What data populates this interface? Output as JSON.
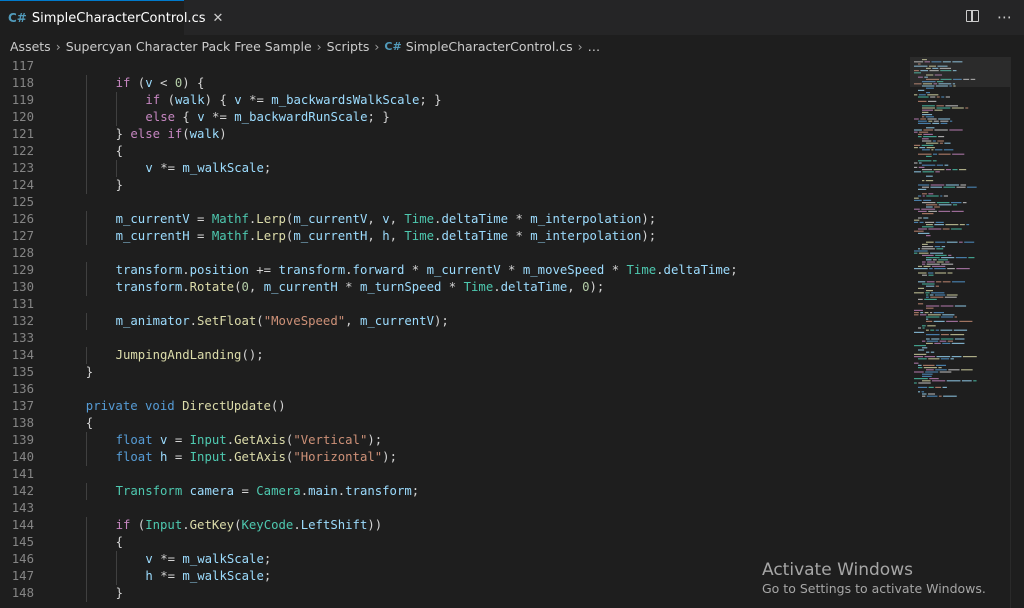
{
  "tab": {
    "icon": "C#",
    "title": "SimpleCharacterControl.cs",
    "close": "✕"
  },
  "actions": {
    "more": "⋯"
  },
  "breadcrumb": {
    "items": [
      "Assets",
      "Supercyan Character Pack Free Sample",
      "Scripts"
    ],
    "file_icon": "C#",
    "file": "SimpleCharacterControl.cs",
    "more": "…"
  },
  "code": {
    "lines": [
      {
        "n": "117",
        "t": ""
      },
      {
        "n": "118",
        "t": "if (v < 0) {"
      },
      {
        "n": "119",
        "t": "if (walk) { v *= m_backwardsWalkScale; }"
      },
      {
        "n": "120",
        "t": "else { v *= m_backwardRunScale; }"
      },
      {
        "n": "121",
        "t": "} else if(walk)"
      },
      {
        "n": "122",
        "t": "{"
      },
      {
        "n": "123",
        "t": "v *= m_walkScale;"
      },
      {
        "n": "124",
        "t": "}"
      },
      {
        "n": "125",
        "t": ""
      },
      {
        "n": "126",
        "t": "m_currentV = Mathf.Lerp(m_currentV, v, Time.deltaTime * m_interpolation);"
      },
      {
        "n": "127",
        "t": "m_currentH = Mathf.Lerp(m_currentH, h, Time.deltaTime * m_interpolation);"
      },
      {
        "n": "128",
        "t": ""
      },
      {
        "n": "129",
        "t": "transform.position += transform.forward * m_currentV * m_moveSpeed * Time.deltaTime;"
      },
      {
        "n": "130",
        "t": "transform.Rotate(0, m_currentH * m_turnSpeed * Time.deltaTime, 0);"
      },
      {
        "n": "131",
        "t": ""
      },
      {
        "n": "132",
        "t": "m_animator.SetFloat(\"MoveSpeed\", m_currentV);"
      },
      {
        "n": "133",
        "t": ""
      },
      {
        "n": "134",
        "t": "JumpingAndLanding();"
      },
      {
        "n": "135",
        "t": "}"
      },
      {
        "n": "136",
        "t": ""
      },
      {
        "n": "137",
        "t": "private void DirectUpdate()"
      },
      {
        "n": "138",
        "t": "{"
      },
      {
        "n": "139",
        "t": "float v = Input.GetAxis(\"Vertical\");"
      },
      {
        "n": "140",
        "t": "float h = Input.GetAxis(\"Horizontal\");"
      },
      {
        "n": "141",
        "t": ""
      },
      {
        "n": "142",
        "t": "Transform camera = Camera.main.transform;"
      },
      {
        "n": "143",
        "t": ""
      },
      {
        "n": "144",
        "t": "if (Input.GetKey(KeyCode.LeftShift))"
      },
      {
        "n": "145",
        "t": "{"
      },
      {
        "n": "146",
        "t": "v *= m_walkScale;"
      },
      {
        "n": "147",
        "t": "h *= m_walkScale;"
      },
      {
        "n": "148",
        "t": "}"
      }
    ]
  },
  "watermark": {
    "title": "Activate Windows",
    "subtitle": "Go to Settings to activate Windows."
  },
  "colors": {
    "keyword": "#569cd6",
    "control": "#c586c0",
    "type": "#4ec9b0",
    "function": "#dcdcaa",
    "variable": "#9cdcfe",
    "string": "#ce9178",
    "number": "#b5cea8",
    "text": "#d4d4d4",
    "line_number": "#858585"
  }
}
